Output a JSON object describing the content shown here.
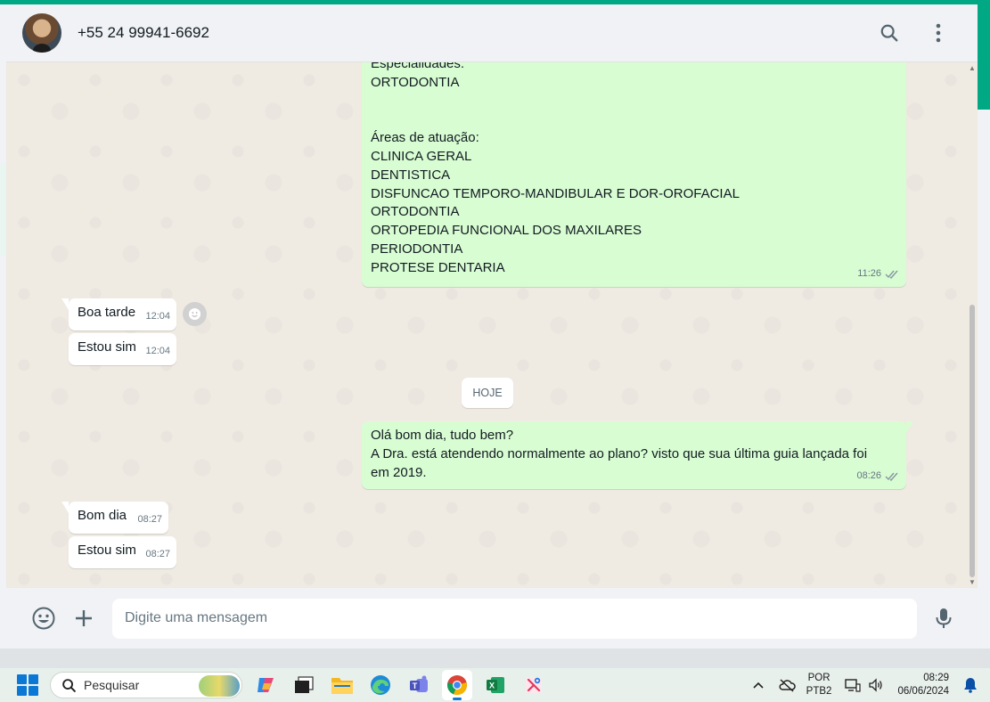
{
  "header": {
    "contact_name": "+55 24 99941-6692"
  },
  "icons": {
    "search": "search-icon",
    "menu": "kebab-menu-icon",
    "emoji": "emoji-icon",
    "plus": "plus-icon",
    "mic": "microphone-icon",
    "read": "double-check-icon",
    "react": "smiley-icon"
  },
  "colors": {
    "accent": "#00a884",
    "outgoing_bubble": "#d9fdd3",
    "incoming_bubble": "#ffffff",
    "chat_bg": "#efeae2"
  },
  "messages": {
    "m1": {
      "lines": [
        "Especialidades:",
        "ORTODONTIA"
      ],
      "lines2": [
        "Áreas de atuação:",
        "CLINICA GERAL",
        "DENTISTICA",
        "DISFUNCAO TEMPORO-MANDIBULAR E DOR-OROFACIAL",
        "ORTODONTIA",
        "ORTOPEDIA FUNCIONAL DOS MAXILARES",
        "PERIODONTIA",
        "PROTESE DENTARIA"
      ],
      "time": "11:26"
    },
    "m2": {
      "text": "Boa tarde",
      "time": "12:04"
    },
    "m3": {
      "text": "Estou sim",
      "time": "12:04"
    },
    "date_chip": "HOJE",
    "m4": {
      "lines": [
        "Olá bom dia, tudo bem?",
        "A Dra. está atendendo normalmente ao plano? visto que sua última guia lançada foi",
        "em 2019."
      ],
      "time": "08:26"
    },
    "m5": {
      "text": "Bom dia",
      "time": "08:27"
    },
    "m6": {
      "text": "Estou sim",
      "time": "08:27"
    }
  },
  "composer": {
    "placeholder": "Digite uma mensagem"
  },
  "taskbar": {
    "search_label": "Pesquisar",
    "lang_top": "POR",
    "lang_bottom": "PTB2",
    "time": "08:29",
    "date": "06/06/2024"
  }
}
